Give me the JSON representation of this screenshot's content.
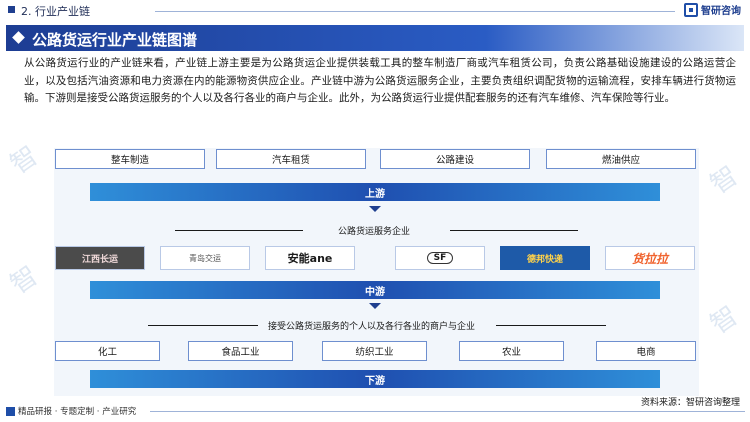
{
  "header": {
    "section_title": "2. 行业产业链",
    "brand_name": "智研咨询"
  },
  "title": "公路货运行业产业链图谱",
  "paragraph": "从公路货运行业的产业链来看，产业链上游主要是为公路货运企业提供装载工具的整车制造厂商或汽车租赁公司，负责公路基础设施建设的公路运营企业，以及包括汽油资源和电力资源在内的能源物资供应企业。产业链中游为公路货运服务企业，主要负责组织调配货物的运输流程，安排车辆进行货物运输。下游则是接受公路货运服务的个人以及各行各业的商户与企业。此外，为公路货运行业提供配套服务的还有汽车维修、汽车保险等行业。",
  "upstream": {
    "items": [
      "整车制造",
      "汽车租赁",
      "公路建设",
      "燃油供应"
    ],
    "band_label": "上游"
  },
  "midstream": {
    "sub_label": "公路货运服务企业",
    "logos": [
      "江西长运",
      "青岛交运",
      "安能ane",
      "SF",
      "德邦快递",
      "货拉拉"
    ],
    "band_label": "中游"
  },
  "downstream": {
    "sub_label": "接受公路货运服务的个人以及各行各业的商户与企业",
    "items": [
      "化工",
      "食品工业",
      "纺织工业",
      "农业",
      "电商"
    ],
    "band_label": "下游"
  },
  "footer": {
    "left": "精品研报 · 专题定制 · 产业研究",
    "source": "资料来源：智研咨询整理"
  },
  "colors": {
    "primary": "#1f3f8f",
    "accent": "#2f8fd9",
    "border": "#6e8fcf"
  }
}
